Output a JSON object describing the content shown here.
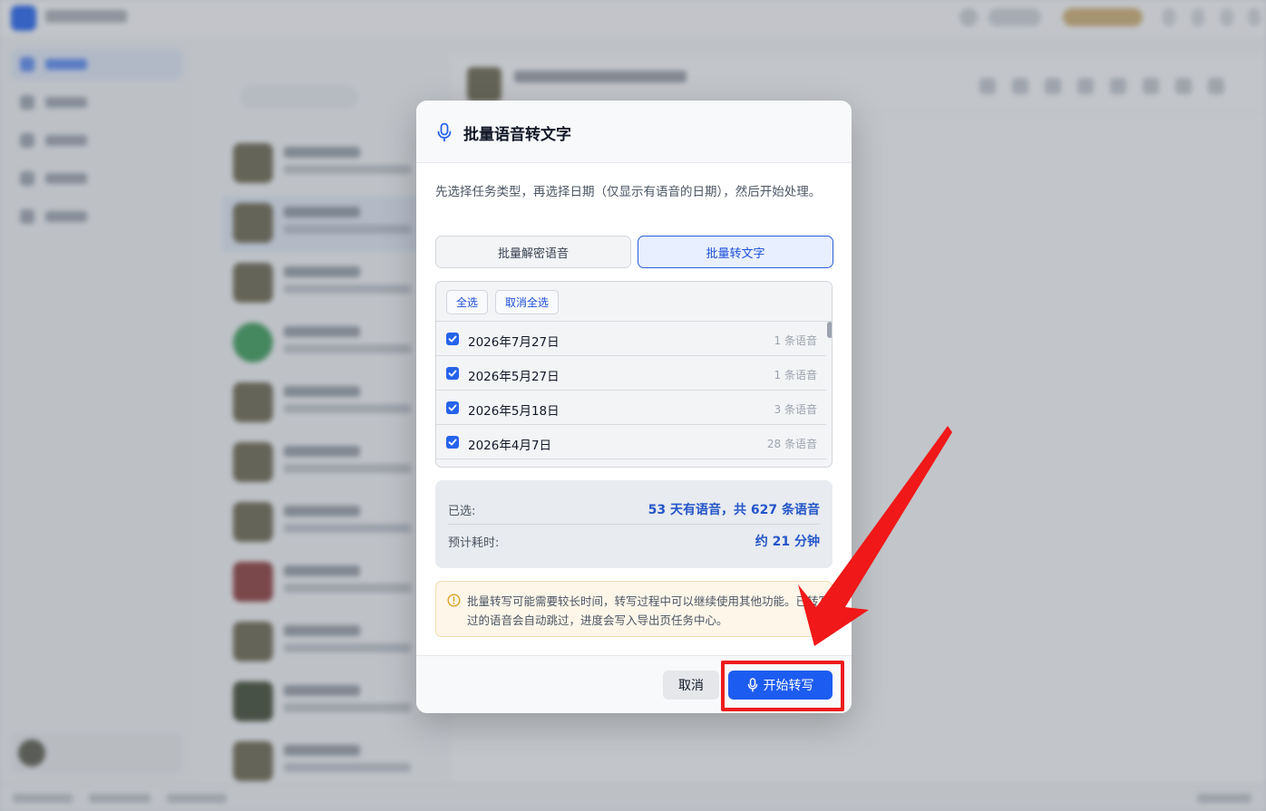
{
  "dialog": {
    "title": "批量语音转文字",
    "description": "先选择任务类型，再选择日期（仅显示有语音的日期），然后开始处理。",
    "task_types": [
      {
        "label": "批量解密语音",
        "selected": false
      },
      {
        "label": "批量转文字",
        "selected": true
      }
    ],
    "select_all_label": "全选",
    "deselect_all_label": "取消全选",
    "dates": [
      {
        "date": "2026年7月27日",
        "count": "1 条语音",
        "checked": true
      },
      {
        "date": "2026年5月27日",
        "count": "1 条语音",
        "checked": true
      },
      {
        "date": "2026年5月18日",
        "count": "3 条语音",
        "checked": true
      },
      {
        "date": "2026年4月7日",
        "count": "28 条语音",
        "checked": true
      }
    ],
    "summary": {
      "selected_label": "已选:",
      "selected_value": "53 天有语音，共 627 条语音",
      "eta_label": "预计耗时:",
      "eta_value": "约 21 分钟"
    },
    "warning": "批量转写可能需要较长时间，转写过程中可以继续使用其他功能。已转写过的语音会自动跳过，进度会写入导出页任务中心。",
    "cancel_label": "取消",
    "start_label": "开始转写"
  },
  "colors": {
    "accent": "#1d5cf0",
    "selected_text": "#2456c9",
    "warning_bg": "#fdf6e9",
    "annotation": "#ef1c1c"
  }
}
